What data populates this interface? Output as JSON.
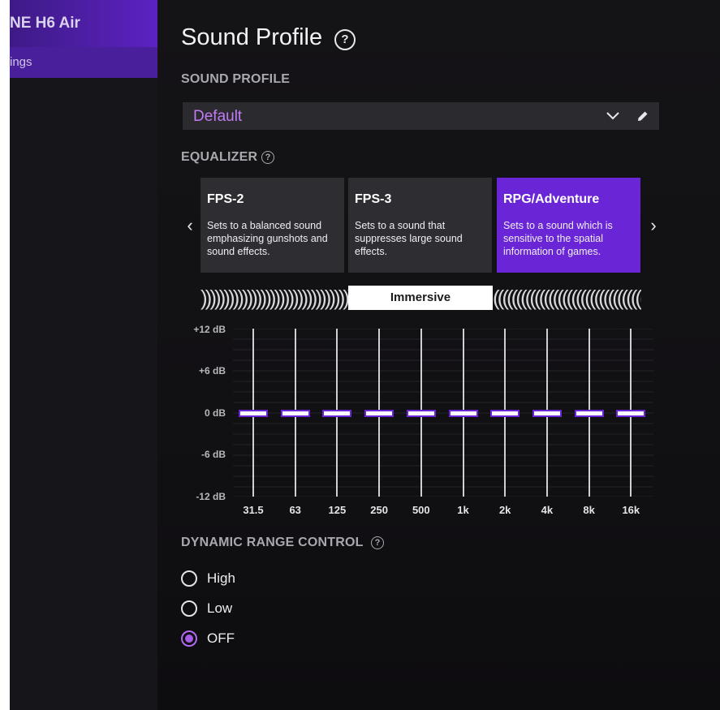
{
  "sidebar": {
    "device_name": "NE H6 Air",
    "settings_label": "ings"
  },
  "page": {
    "title": "Sound Profile",
    "help_icon": "?"
  },
  "sound_profile": {
    "label": "SOUND PROFILE",
    "selected_value": "Default"
  },
  "equalizer": {
    "label": "EQUALIZER",
    "presets": [
      {
        "title": "FPS-2",
        "description": "Sets to a balanced sound emphasizing gunshots and sound effects.",
        "selected": false
      },
      {
        "title": "FPS-3",
        "description": "Sets to a sound that suppresses large sound effects.",
        "selected": false
      },
      {
        "title": "RPG/Adventure",
        "description": "Sets to a sound which is sensitive to the spatial information of games.",
        "selected": true
      }
    ],
    "mode_label": "Immersive",
    "db_labels": [
      "+12 dB",
      "+6 dB",
      "0 dB",
      "-6 dB",
      "-12 dB"
    ],
    "bands": [
      {
        "freq": "31.5",
        "gain_db": 0
      },
      {
        "freq": "63",
        "gain_db": 0
      },
      {
        "freq": "125",
        "gain_db": 0
      },
      {
        "freq": "250",
        "gain_db": 0
      },
      {
        "freq": "500",
        "gain_db": 0
      },
      {
        "freq": "1k",
        "gain_db": 0
      },
      {
        "freq": "2k",
        "gain_db": 0
      },
      {
        "freq": "4k",
        "gain_db": 0
      },
      {
        "freq": "8k",
        "gain_db": 0
      },
      {
        "freq": "16k",
        "gain_db": 0
      }
    ]
  },
  "dynamic_range": {
    "label": "DYNAMIC RANGE CONTROL",
    "options": [
      {
        "label": "High",
        "checked": false
      },
      {
        "label": "Low",
        "checked": false
      },
      {
        "label": "OFF",
        "checked": true
      }
    ]
  },
  "colors": {
    "accent": "#6a25d6",
    "accent_text": "#c17bf2"
  }
}
